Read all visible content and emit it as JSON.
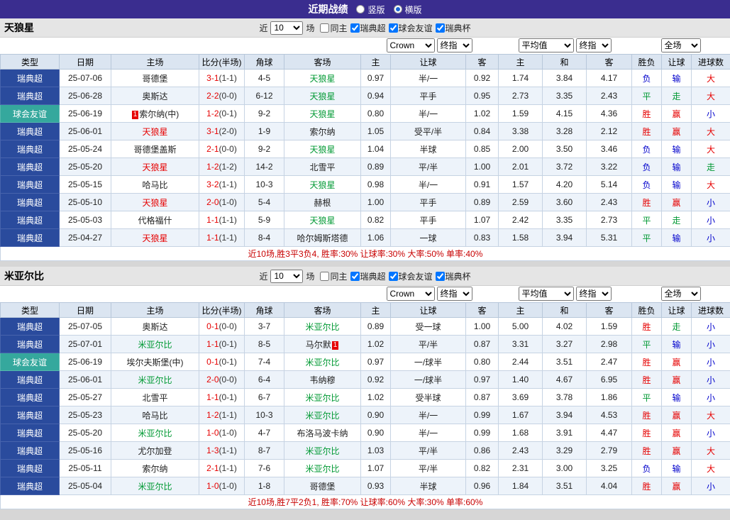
{
  "page": {
    "title": "近期战绩",
    "view_options": [
      {
        "label": "竖版",
        "selected": false
      },
      {
        "label": "横版",
        "selected": true
      }
    ]
  },
  "filters": {
    "near_label": "近",
    "matches_count": "10",
    "games_label": "场",
    "checkboxes": [
      {
        "label": "同主",
        "checked": false
      },
      {
        "label": "瑞典超",
        "checked": true
      },
      {
        "label": "球会友谊",
        "checked": true
      },
      {
        "label": "瑞典杯",
        "checked": true
      }
    ]
  },
  "table_header": {
    "cols": [
      "类型",
      "日期",
      "主场",
      "比分(半场)",
      "角球",
      "客场",
      "主",
      "让球",
      "客",
      "主",
      "和",
      "客",
      "胜负",
      "让球",
      "进球数"
    ],
    "dropdowns": {
      "bookmaker": "Crown",
      "final1": "终指",
      "average": "平均值",
      "final2": "终指",
      "fullmatch": "全场"
    }
  },
  "teams": [
    {
      "name": "天狼星",
      "summary": "近10场,胜3平3负4, 胜率:30% 让球率:30% 大率:50% 单率:40%",
      "rows": [
        {
          "type": "瑞典超",
          "type_style": "league",
          "date": "25-07-06",
          "home": "哥德堡",
          "home_color": "k",
          "away": "天狼星",
          "away_color": "g",
          "score": "3-1",
          "half": "(1-1)",
          "corners": "4-5",
          "odds": [
            "0.97",
            "半/一",
            "0.92"
          ],
          "avg": [
            "1.74",
            "3.84",
            "4.17"
          ],
          "results": [
            [
              "负",
              "b"
            ],
            [
              "输",
              "b"
            ],
            [
              "大",
              "r"
            ]
          ]
        },
        {
          "type": "瑞典超",
          "type_style": "league",
          "date": "25-06-28",
          "home": "奥斯达",
          "home_color": "k",
          "away": "天狼星",
          "away_color": "g",
          "score": "2-2",
          "half": "(0-0)",
          "corners": "6-12",
          "odds": [
            "0.94",
            "平手",
            "0.95"
          ],
          "avg": [
            "2.73",
            "3.35",
            "2.43"
          ],
          "results": [
            [
              "平",
              "g"
            ],
            [
              "走",
              "g"
            ],
            [
              "大",
              "r"
            ]
          ]
        },
        {
          "type": "球会友谊",
          "type_style": "friendly",
          "date": "25-06-19",
          "home": "索尔纳(中)",
          "home_color": "k",
          "home_badge": "1",
          "home_badge_pos": "before",
          "away": "天狼星",
          "away_color": "g",
          "score": "1-2",
          "half": "(0-1)",
          "corners": "9-2",
          "odds": [
            "0.80",
            "半/一",
            "1.02"
          ],
          "avg": [
            "1.59",
            "4.15",
            "4.36"
          ],
          "results": [
            [
              "胜",
              "r"
            ],
            [
              "赢",
              "r"
            ],
            [
              "小",
              "b"
            ]
          ]
        },
        {
          "type": "瑞典超",
          "type_style": "league",
          "date": "25-06-01",
          "home": "天狼星",
          "home_color": "r",
          "away": "索尔纳",
          "away_color": "k",
          "score": "3-1",
          "half": "(2-0)",
          "corners": "1-9",
          "odds": [
            "1.05",
            "受平/半",
            "0.84"
          ],
          "avg": [
            "3.38",
            "3.28",
            "2.12"
          ],
          "results": [
            [
              "胜",
              "r"
            ],
            [
              "赢",
              "r"
            ],
            [
              "大",
              "r"
            ]
          ]
        },
        {
          "type": "瑞典超",
          "type_style": "league",
          "date": "25-05-24",
          "home": "哥德堡盖斯",
          "home_color": "k",
          "away": "天狼星",
          "away_color": "g",
          "score": "2-1",
          "half": "(0-0)",
          "corners": "9-2",
          "odds": [
            "1.04",
            "半球",
            "0.85"
          ],
          "avg": [
            "2.00",
            "3.50",
            "3.46"
          ],
          "results": [
            [
              "负",
              "b"
            ],
            [
              "输",
              "b"
            ],
            [
              "大",
              "r"
            ]
          ]
        },
        {
          "type": "瑞典超",
          "type_style": "league",
          "date": "25-05-20",
          "home": "天狼星",
          "home_color": "r",
          "away": "北雪平",
          "away_color": "k",
          "score": "1-2",
          "half": "(1-2)",
          "corners": "14-2",
          "odds": [
            "0.89",
            "平/半",
            "1.00"
          ],
          "avg": [
            "2.01",
            "3.72",
            "3.22"
          ],
          "results": [
            [
              "负",
              "b"
            ],
            [
              "输",
              "b"
            ],
            [
              "走",
              "g"
            ]
          ]
        },
        {
          "type": "瑞典超",
          "type_style": "league",
          "date": "25-05-15",
          "home": "哈马比",
          "home_color": "k",
          "away": "天狼星",
          "away_color": "g",
          "score": "3-2",
          "half": "(1-1)",
          "corners": "10-3",
          "odds": [
            "0.98",
            "半/一",
            "0.91"
          ],
          "avg": [
            "1.57",
            "4.20",
            "5.14"
          ],
          "results": [
            [
              "负",
              "b"
            ],
            [
              "输",
              "b"
            ],
            [
              "大",
              "r"
            ]
          ]
        },
        {
          "type": "瑞典超",
          "type_style": "league",
          "date": "25-05-10",
          "home": "天狼星",
          "home_color": "r",
          "away": "赫根",
          "away_color": "k",
          "score": "2-0",
          "half": "(1-0)",
          "corners": "5-4",
          "odds": [
            "1.00",
            "平手",
            "0.89"
          ],
          "avg": [
            "2.59",
            "3.60",
            "2.43"
          ],
          "results": [
            [
              "胜",
              "r"
            ],
            [
              "赢",
              "r"
            ],
            [
              "小",
              "b"
            ]
          ]
        },
        {
          "type": "瑞典超",
          "type_style": "league",
          "date": "25-05-03",
          "home": "代格福什",
          "home_color": "k",
          "away": "天狼星",
          "away_color": "g",
          "score": "1-1",
          "half": "(1-1)",
          "corners": "5-9",
          "odds": [
            "0.82",
            "平手",
            "1.07"
          ],
          "avg": [
            "2.42",
            "3.35",
            "2.73"
          ],
          "results": [
            [
              "平",
              "g"
            ],
            [
              "走",
              "g"
            ],
            [
              "小",
              "b"
            ]
          ]
        },
        {
          "type": "瑞典超",
          "type_style": "league",
          "date": "25-04-27",
          "home": "天狼星",
          "home_color": "r",
          "away": "哈尔姆斯塔德",
          "away_color": "k",
          "score": "1-1",
          "half": "(1-1)",
          "corners": "8-4",
          "odds": [
            "1.06",
            "一球",
            "0.83"
          ],
          "avg": [
            "1.58",
            "3.94",
            "5.31"
          ],
          "results": [
            [
              "平",
              "g"
            ],
            [
              "输",
              "b"
            ],
            [
              "小",
              "b"
            ]
          ]
        }
      ]
    },
    {
      "name": "米亚尔比",
      "summary": "近10场,胜7平2负1, 胜率:70% 让球率:60% 大率:30% 单率:60%",
      "rows": [
        {
          "type": "瑞典超",
          "type_style": "league",
          "date": "25-07-05",
          "home": "奥斯达",
          "home_color": "k",
          "away": "米亚尔比",
          "away_color": "g",
          "score": "0-1",
          "half": "(0-0)",
          "corners": "3-7",
          "odds": [
            "0.89",
            "受一球",
            "1.00"
          ],
          "avg": [
            "5.00",
            "4.02",
            "1.59"
          ],
          "results": [
            [
              "胜",
              "r"
            ],
            [
              "走",
              "g"
            ],
            [
              "小",
              "b"
            ]
          ]
        },
        {
          "type": "瑞典超",
          "type_style": "league",
          "date": "25-07-01",
          "home": "米亚尔比",
          "home_color": "g",
          "away": "马尔默",
          "away_color": "k",
          "away_badge": "1",
          "away_badge_pos": "after",
          "score": "1-1",
          "half": "(0-1)",
          "corners": "8-5",
          "odds": [
            "1.02",
            "平/半",
            "0.87"
          ],
          "avg": [
            "3.31",
            "3.27",
            "2.98"
          ],
          "results": [
            [
              "平",
              "g"
            ],
            [
              "输",
              "b"
            ],
            [
              "小",
              "b"
            ]
          ]
        },
        {
          "type": "球会友谊",
          "type_style": "friendly",
          "date": "25-06-19",
          "home": "埃尔夫斯堡(中)",
          "home_color": "k",
          "away": "米亚尔比",
          "away_color": "g",
          "score": "0-1",
          "half": "(0-1)",
          "corners": "7-4",
          "odds": [
            "0.97",
            "一/球半",
            "0.80"
          ],
          "avg": [
            "2.44",
            "3.51",
            "2.47"
          ],
          "results": [
            [
              "胜",
              "r"
            ],
            [
              "赢",
              "r"
            ],
            [
              "小",
              "b"
            ]
          ]
        },
        {
          "type": "瑞典超",
          "type_style": "league",
          "date": "25-06-01",
          "home": "米亚尔比",
          "home_color": "g",
          "away": "韦纳穆",
          "away_color": "k",
          "score": "2-0",
          "half": "(0-0)",
          "corners": "6-4",
          "odds": [
            "0.92",
            "一/球半",
            "0.97"
          ],
          "avg": [
            "1.40",
            "4.67",
            "6.95"
          ],
          "results": [
            [
              "胜",
              "r"
            ],
            [
              "赢",
              "r"
            ],
            [
              "小",
              "b"
            ]
          ]
        },
        {
          "type": "瑞典超",
          "type_style": "league",
          "date": "25-05-27",
          "home": "北雪平",
          "home_color": "k",
          "away": "米亚尔比",
          "away_color": "g",
          "score": "1-1",
          "half": "(0-1)",
          "corners": "6-7",
          "odds": [
            "1.02",
            "受半球",
            "0.87"
          ],
          "avg": [
            "3.69",
            "3.78",
            "1.86"
          ],
          "results": [
            [
              "平",
              "g"
            ],
            [
              "输",
              "b"
            ],
            [
              "小",
              "b"
            ]
          ]
        },
        {
          "type": "瑞典超",
          "type_style": "league",
          "date": "25-05-23",
          "home": "哈马比",
          "home_color": "k",
          "away": "米亚尔比",
          "away_color": "g",
          "score": "1-2",
          "half": "(1-1)",
          "corners": "10-3",
          "odds": [
            "0.90",
            "半/一",
            "0.99"
          ],
          "avg": [
            "1.67",
            "3.94",
            "4.53"
          ],
          "results": [
            [
              "胜",
              "r"
            ],
            [
              "赢",
              "r"
            ],
            [
              "大",
              "r"
            ]
          ]
        },
        {
          "type": "瑞典超",
          "type_style": "league",
          "date": "25-05-20",
          "home": "米亚尔比",
          "home_color": "g",
          "away": "布洛马波卡纳",
          "away_color": "k",
          "score": "1-0",
          "half": "(1-0)",
          "corners": "4-7",
          "odds": [
            "0.90",
            "半/一",
            "0.99"
          ],
          "avg": [
            "1.68",
            "3.91",
            "4.47"
          ],
          "results": [
            [
              "胜",
              "r"
            ],
            [
              "赢",
              "r"
            ],
            [
              "小",
              "b"
            ]
          ]
        },
        {
          "type": "瑞典超",
          "type_style": "league",
          "date": "25-05-16",
          "home": "尤尔加登",
          "home_color": "k",
          "away": "米亚尔比",
          "away_color": "g",
          "score": "1-3",
          "half": "(1-1)",
          "corners": "8-7",
          "odds": [
            "1.03",
            "平/半",
            "0.86"
          ],
          "avg": [
            "2.43",
            "3.29",
            "2.79"
          ],
          "results": [
            [
              "胜",
              "r"
            ],
            [
              "赢",
              "r"
            ],
            [
              "大",
              "r"
            ]
          ]
        },
        {
          "type": "瑞典超",
          "type_style": "league",
          "date": "25-05-11",
          "home": "索尔纳",
          "home_color": "k",
          "away": "米亚尔比",
          "away_color": "g",
          "score": "2-1",
          "half": "(1-1)",
          "corners": "7-6",
          "odds": [
            "1.07",
            "平/半",
            "0.82"
          ],
          "avg": [
            "2.31",
            "3.00",
            "3.25"
          ],
          "results": [
            [
              "负",
              "b"
            ],
            [
              "输",
              "b"
            ],
            [
              "大",
              "r"
            ]
          ]
        },
        {
          "type": "瑞典超",
          "type_style": "league",
          "date": "25-05-04",
          "home": "米亚尔比",
          "home_color": "g",
          "away": "哥德堡",
          "away_color": "k",
          "score": "1-0",
          "half": "(1-0)",
          "corners": "1-8",
          "odds": [
            "0.93",
            "半球",
            "0.96"
          ],
          "avg": [
            "1.84",
            "3.51",
            "4.04"
          ],
          "results": [
            [
              "胜",
              "r"
            ],
            [
              "赢",
              "r"
            ],
            [
              "小",
              "b"
            ]
          ]
        }
      ]
    }
  ]
}
